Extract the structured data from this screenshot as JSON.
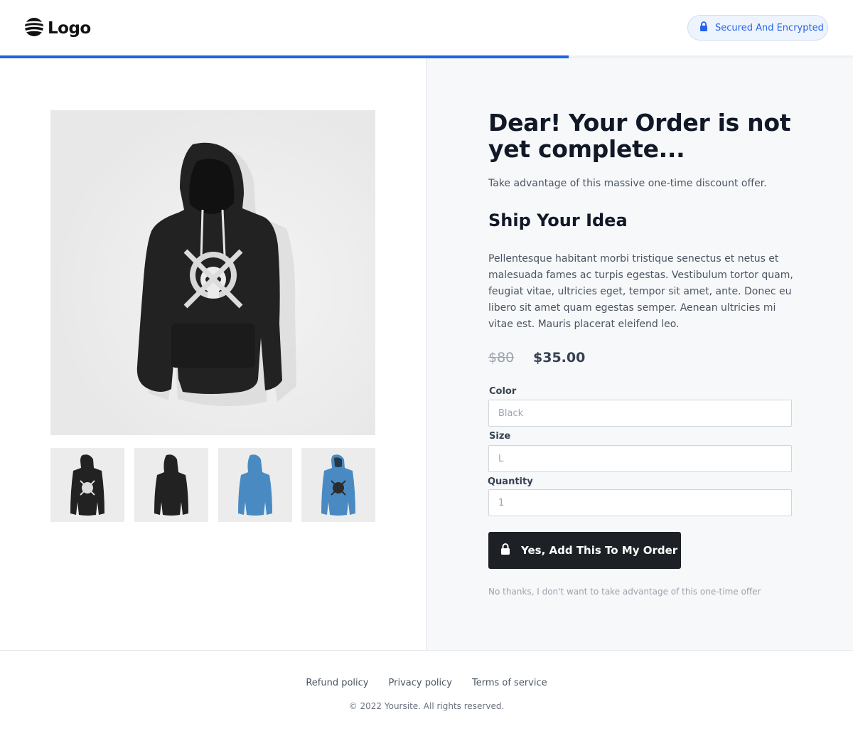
{
  "header": {
    "logo_text": "Logo",
    "secure_badge": "Secured And Encrypted",
    "progress_percent": 66.7
  },
  "offer": {
    "title": "Dear! Your Order is not yet complete...",
    "subtitle": "Take advantage of this massive one-time discount offer.",
    "product_name": "Ship Your Idea",
    "description": "Pellentesque habitant morbi tristique senectus et netus et malesuada fames ac turpis egestas. Vestibulum tortor quam, feugiat vitae, ultricies eget, tempor sit amet, ante. Donec eu libero sit amet quam egestas semper. Aenean ultricies mi vitae est. Mauris placerat eleifend leo.",
    "price_old": "$80",
    "price_new": "$35.00"
  },
  "form": {
    "color_label": "Color",
    "color_value": "Black",
    "size_label": "Size",
    "size_value": "L",
    "quantity_label": "Quantity",
    "quantity_value": "1"
  },
  "actions": {
    "cta_label": "Yes, Add This To My Order",
    "decline_label": "No thanks, I don't want to take advantage of this one-time offer"
  },
  "footer": {
    "links": [
      "Refund policy",
      "Privacy policy",
      "Terms of service"
    ],
    "copyright": "© 2022 Yoursite. All rights reserved."
  },
  "images": {
    "main": "black-hoodie-skull-front",
    "thumbnails": [
      "black-hoodie-skull-front",
      "black-hoodie-back",
      "blue-hoodie-back",
      "blue-hoodie-skull-front"
    ]
  },
  "colors": {
    "accent": "#1c64e3",
    "cta_background": "#1d2024",
    "hoodie_black": "#222222",
    "hoodie_blue": "#4a8ac2"
  }
}
